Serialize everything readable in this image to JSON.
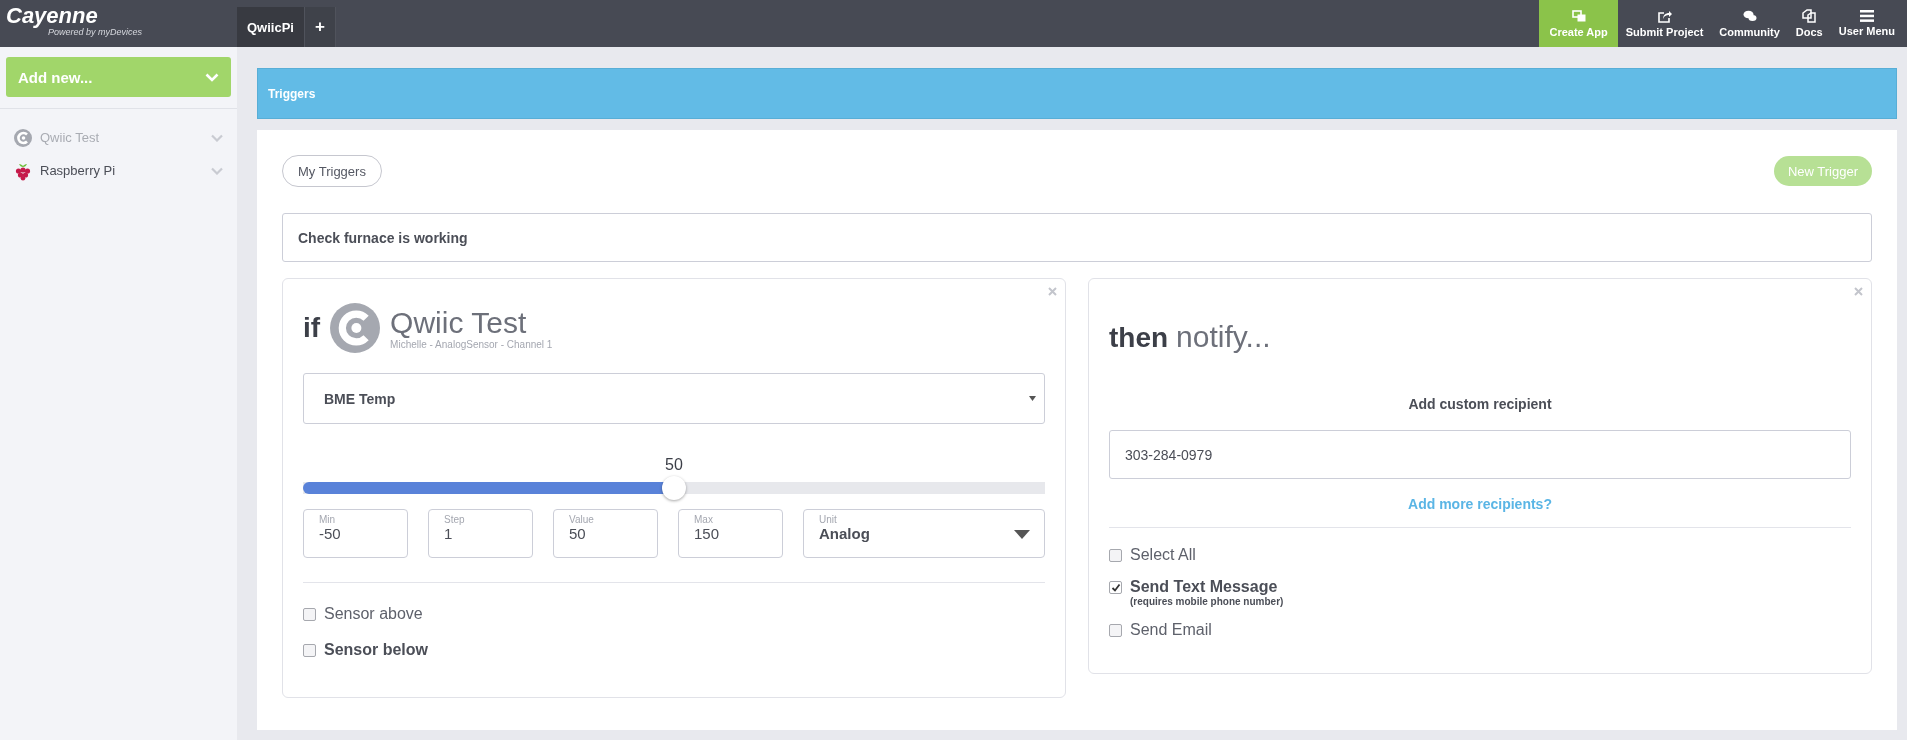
{
  "logo": {
    "name": "Cayenne",
    "tagline": "Powered by myDevices"
  },
  "tabs": [
    {
      "label": "QwiicPi",
      "selected": true
    },
    {
      "label": "+",
      "selected": false
    }
  ],
  "nav": [
    {
      "label": "Create App",
      "kind": "apps",
      "selected": true
    },
    {
      "label": "Submit Project",
      "kind": "share",
      "selected": false
    },
    {
      "label": "Community",
      "kind": "chat",
      "selected": false
    },
    {
      "label": "Docs",
      "kind": "docs",
      "selected": false
    },
    {
      "label": "User Menu",
      "kind": "menu",
      "selected": false
    }
  ],
  "sidebar": {
    "add_button": "Add new...",
    "items": [
      {
        "label": "Qwiic Test",
        "kind": "cayenne",
        "disabled": true
      },
      {
        "label": "Raspberry Pi",
        "kind": "raspberry",
        "disabled": false
      }
    ]
  },
  "header": {
    "title": "Triggers"
  },
  "toolbar": {
    "my_triggers": "My Triggers",
    "new_trigger": "New Trigger"
  },
  "trigger_name": "Check furnace is working",
  "if_card": {
    "keyword": "if",
    "device": "Qwiic Test",
    "subtitle": "Michelle -  AnalogSensor -  Channel 1",
    "channel": "BME Temp",
    "slider": {
      "reading": "50",
      "level": 0.5
    },
    "fields": [
      {
        "label": "Min",
        "value": "-50",
        "kind": "text"
      },
      {
        "label": "Step",
        "value": "1",
        "kind": "text"
      },
      {
        "label": "Value",
        "value": "50",
        "kind": "text"
      },
      {
        "label": "Max",
        "value": "150",
        "kind": "text"
      },
      {
        "label": "Unit",
        "value": "Analog",
        "kind": "select"
      }
    ],
    "conditions": [
      {
        "label": "Sensor above",
        "checked": false,
        "selected": false
      },
      {
        "label": "Sensor below",
        "checked": false,
        "selected": true
      }
    ]
  },
  "then_card": {
    "keyword": "then",
    "action": "notify...",
    "recipient_label": "Add custom recipient",
    "recipient": "303-284-0979",
    "more_link": "Add more recipients?",
    "options": [
      {
        "label": "Select All",
        "checked": false
      },
      {
        "label": "Send Text Message",
        "note": "(requires mobile phone number)",
        "checked": true
      },
      {
        "label": "Send Email",
        "checked": false
      }
    ]
  }
}
